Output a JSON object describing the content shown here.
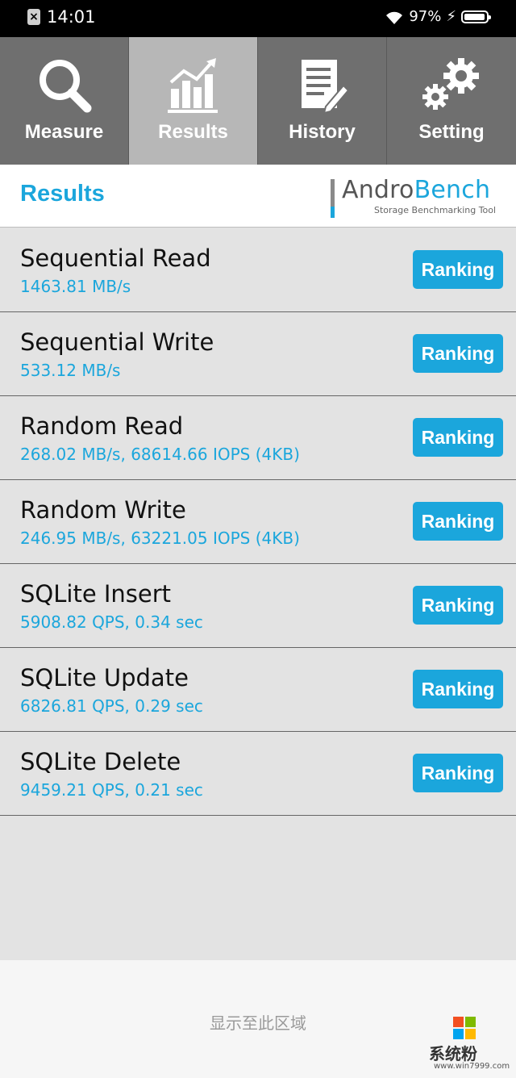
{
  "status_bar": {
    "time": "14:01",
    "battery_percent": "97%",
    "battery_level": 0.97,
    "icons": [
      "sim-error-icon",
      "wifi-icon",
      "charging-bolt-icon",
      "battery-icon"
    ]
  },
  "tabs": [
    {
      "label": "Measure",
      "icon": "magnifier-icon",
      "active": false
    },
    {
      "label": "Results",
      "icon": "bar-chart-trend-icon",
      "active": true
    },
    {
      "label": "History",
      "icon": "document-pen-icon",
      "active": false
    },
    {
      "label": "Setting",
      "icon": "gears-icon",
      "active": false
    }
  ],
  "header": {
    "title": "Results",
    "logo": {
      "name_part1": "Andro",
      "name_part2": "Bench",
      "tagline": "Storage Benchmarking Tool"
    }
  },
  "results": [
    {
      "name": "Sequential Read",
      "value": "1463.81 MB/s",
      "button": "Ranking"
    },
    {
      "name": "Sequential Write",
      "value": "533.12 MB/s",
      "button": "Ranking"
    },
    {
      "name": "Random Read",
      "value": "268.02 MB/s, 68614.66 IOPS (4KB)",
      "button": "Ranking"
    },
    {
      "name": "Random Write",
      "value": "246.95 MB/s, 63221.05 IOPS (4KB)",
      "button": "Ranking"
    },
    {
      "name": "SQLite Insert",
      "value": "5908.82 QPS, 0.34 sec",
      "button": "Ranking"
    },
    {
      "name": "SQLite Update",
      "value": "6826.81 QPS, 0.29 sec",
      "button": "Ranking"
    },
    {
      "name": "SQLite Delete",
      "value": "9459.21 QPS, 0.21 sec",
      "button": "Ranking"
    }
  ],
  "bottom": {
    "text": "显示至此区域"
  },
  "watermark": {
    "text": "系统粉",
    "url": "www.win7999.com"
  },
  "colors": {
    "accent": "#1ba6dc",
    "tab_bg": "#6f6f6f",
    "tab_active_bg": "#b7b7b7",
    "list_bg": "#e3e3e3"
  }
}
